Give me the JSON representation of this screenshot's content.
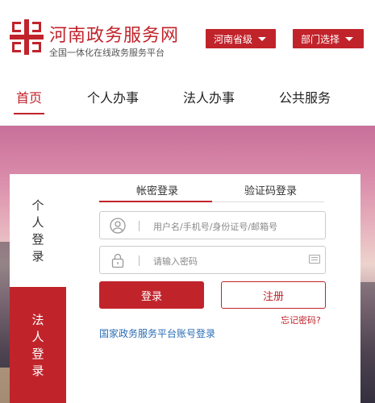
{
  "header": {
    "site_title": "河南政务服务网",
    "site_subtitle": "全国一体化在线政务服务平台",
    "province_select": "河南省级",
    "department_select": "部门选择",
    "brand_color": "#c1232b"
  },
  "nav": {
    "items": [
      {
        "label": "首页",
        "active": true
      },
      {
        "label": "个人办事",
        "active": false
      },
      {
        "label": "法人办事",
        "active": false
      },
      {
        "label": "公共服务",
        "active": false
      }
    ]
  },
  "login": {
    "side_tabs": [
      {
        "chars": [
          "个",
          "人",
          "登",
          "录"
        ],
        "active": false
      },
      {
        "chars": [
          "法",
          "人",
          "登",
          "录"
        ],
        "active": true
      }
    ],
    "tabs": [
      {
        "label": "帐密登录",
        "active": true
      },
      {
        "label": "验证码登录",
        "active": false
      }
    ],
    "username": {
      "placeholder": "用户名/手机号/身份证号/邮箱号",
      "icon": "user-icon"
    },
    "password": {
      "placeholder": "请输入密码",
      "icon": "lock-icon",
      "keyboard_icon": "keyboard-icon"
    },
    "login_button": "登录",
    "register_button": "注册",
    "forgot_password": "忘记密码?",
    "national_login": "国家政务服务平台账号登录"
  }
}
